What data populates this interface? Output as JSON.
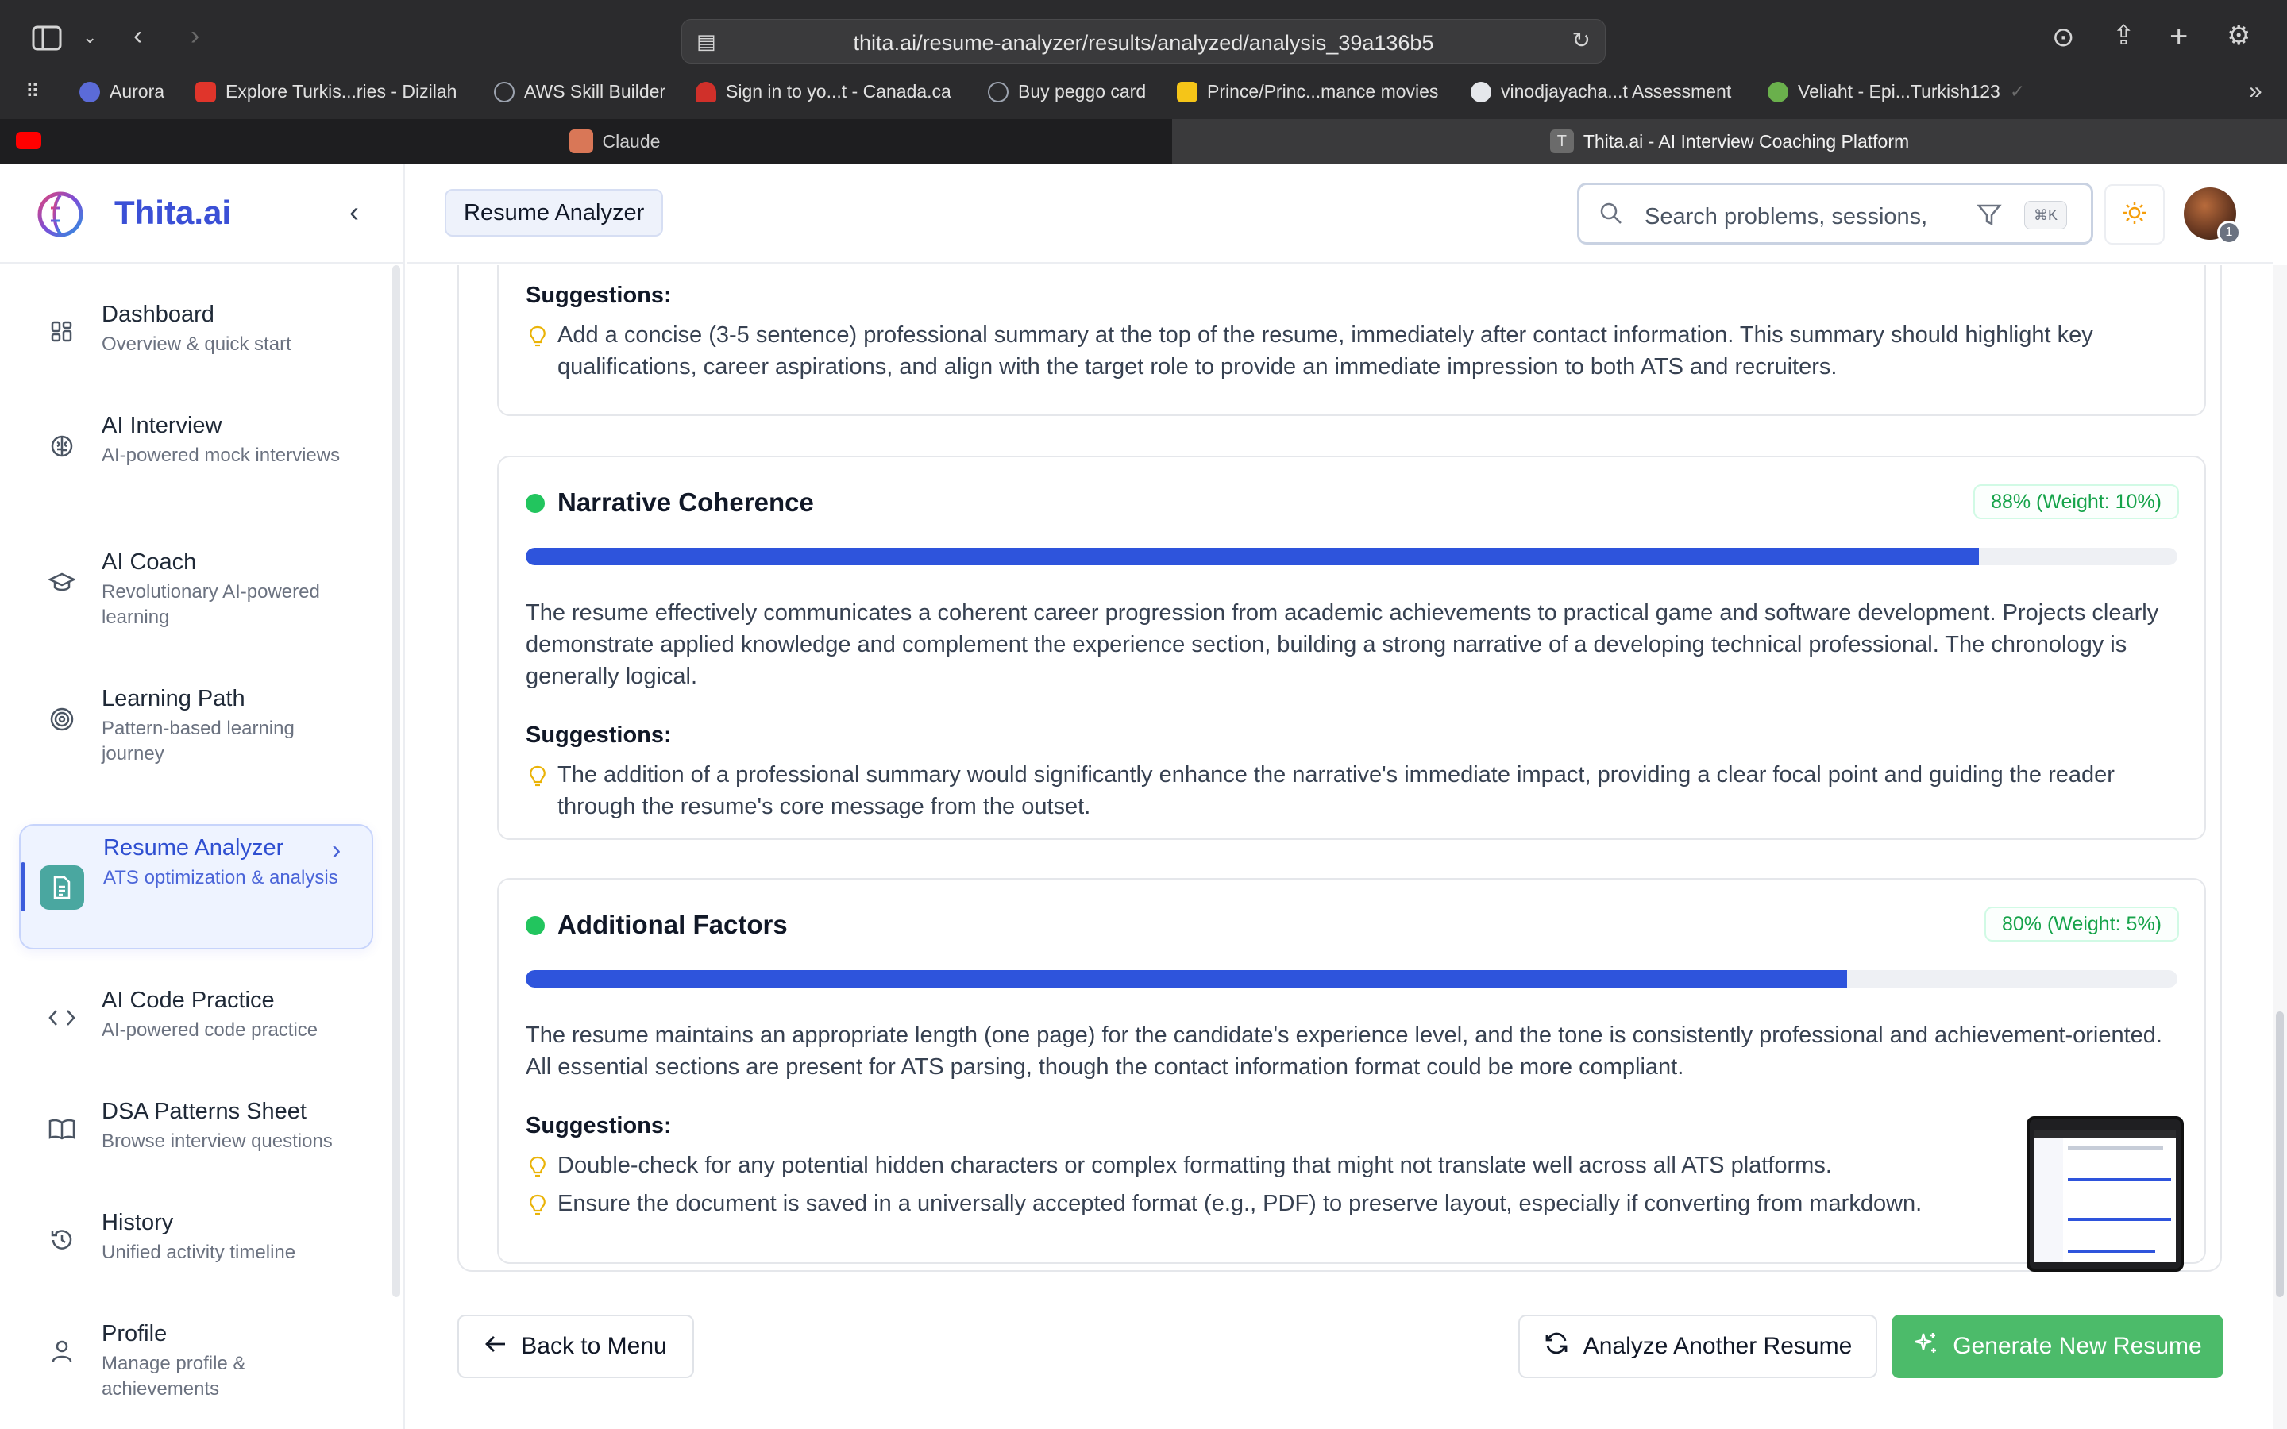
{
  "browser": {
    "url": "thita.ai/resume-analyzer/results/analyzed/analysis_39a136b5",
    "bookmarks": [
      {
        "label": "Aurora",
        "color": "#5b6bd8"
      },
      {
        "label": "Explore Turkis...ries - Dizilah",
        "color": "#e0352b"
      },
      {
        "label": "AWS Skill Builder",
        "color": "#9ca3af"
      },
      {
        "label": "Sign in to yo...t - Canada.ca",
        "color": "#d0302a"
      },
      {
        "label": "Buy peggo card",
        "color": "#9ca3af"
      },
      {
        "label": "Prince/Princ...mance movies",
        "color": "#f5c518"
      },
      {
        "label": "vinodjayacha...t Assessment",
        "color": "#e5e7eb"
      },
      {
        "label": "Veliaht - Epi...Turkish123",
        "color": "#6ab04c"
      }
    ],
    "tabs": [
      {
        "label": "Claude",
        "active": false
      },
      {
        "label": "Thita.ai - AI Interview Coaching Platform",
        "active": true
      }
    ]
  },
  "app": {
    "brand": "Thita.ai",
    "header": {
      "breadcrumb": "Resume Analyzer",
      "search_placeholder": "Search problems, sessions,",
      "shortcut": "⌘K",
      "notifications": "1"
    },
    "nav": [
      {
        "title": "Dashboard",
        "subtitle": "Overview & quick start",
        "icon": "dashboard-icon"
      },
      {
        "title": "AI Interview",
        "subtitle": "AI-powered mock interviews",
        "icon": "brain-icon"
      },
      {
        "title": "AI Coach",
        "subtitle": "Revolutionary AI-powered learning",
        "icon": "graduation-cap-icon"
      },
      {
        "title": "Learning Path",
        "subtitle": "Pattern-based learning journey",
        "icon": "target-icon"
      },
      {
        "title": "Resume Analyzer",
        "subtitle": "ATS optimization & analysis",
        "icon": "document-icon",
        "active": true
      },
      {
        "title": "AI Code Practice",
        "subtitle": "AI-powered code practice",
        "icon": "code-icon"
      },
      {
        "title": "DSA Patterns Sheet",
        "subtitle": "Browse interview questions",
        "icon": "book-icon"
      },
      {
        "title": "History",
        "subtitle": "Unified activity timeline",
        "icon": "history-icon"
      },
      {
        "title": "Profile",
        "subtitle": "Manage profile & achievements",
        "icon": "user-icon"
      }
    ]
  },
  "analysis": {
    "suggestions_label": "Suggestions:",
    "top_card": {
      "suggestions": [
        "Add a concise (3-5 sentence) professional summary at the top of the resume, immediately after contact information. This summary should highlight key qualifications, career aspirations, and align with the target role to provide an immediate impression to both ATS and recruiters."
      ]
    },
    "sections": [
      {
        "title": "Narrative Coherence",
        "score_label": "88% (Weight: 10%)",
        "score": 0.88,
        "description": "The resume effectively communicates a coherent career progression from academic achievements to practical game and software development. Projects clearly demonstrate applied knowledge and complement the experience section, building a strong narrative of a developing technical professional. The chronology is generally logical.",
        "suggestions": [
          "The addition of a professional summary would significantly enhance the narrative's immediate impact, providing a clear focal point and guiding the reader through the resume's core message from the outset."
        ]
      },
      {
        "title": "Additional Factors",
        "score_label": "80% (Weight: 5%)",
        "score": 0.8,
        "description": "The resume maintains an appropriate length (one page) for the candidate's experience level, and the tone is consistently professional and achievement-oriented. All essential sections are present for ATS parsing, though the contact information format could be more compliant.",
        "suggestions": [
          "Double-check for any potential hidden characters or complex formatting that might not translate well across all ATS platforms.",
          "Ensure the document is saved in a universally accepted format (e.g., PDF) to preserve layout, especially if converting from markdown."
        ]
      }
    ]
  },
  "actions": {
    "back": "Back to Menu",
    "analyze_another": "Analyze Another Resume",
    "generate_new": "Generate New Resume"
  },
  "colors": {
    "accent": "#2e54dc",
    "success": "#22c55e",
    "primary_button": "#4cbb6a"
  }
}
